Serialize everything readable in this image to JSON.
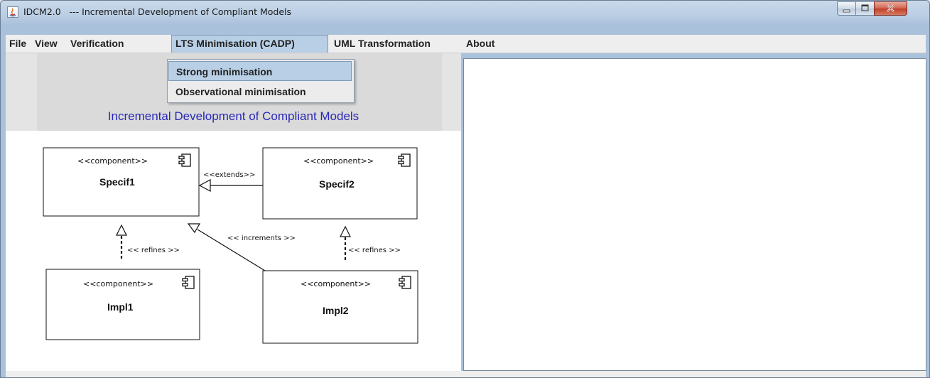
{
  "window": {
    "title": "IDCM2.0   --- Incremental Development of Compliant Models",
    "app_icon": "java-icon",
    "controls": [
      "minimize-icon",
      "maximize-icon",
      "close-icon"
    ]
  },
  "menubar": {
    "items": [
      "File",
      "View",
      "Verification",
      "LTS Minimisation (CADP)",
      "UML Transformation",
      "About"
    ],
    "active_item": "LTS Minimisation (CADP)"
  },
  "dropdown": {
    "items": [
      "Strong minimisation",
      "Observational minimisation"
    ],
    "highlighted": "Strong minimisation"
  },
  "banner": {
    "title": "Incremental Development of Compliant Models",
    "title_color": "#2a2ab8"
  },
  "diagram": {
    "components": [
      {
        "stereotype": "<<component>>",
        "name": "Specif1"
      },
      {
        "stereotype": "<<component>>",
        "name": "Specif2"
      },
      {
        "stereotype": "<<component>>",
        "name": "Impl1"
      },
      {
        "stereotype": "<<component>>",
        "name": "Impl2"
      }
    ],
    "relations": [
      {
        "label": "<<extends>>",
        "from": "Specif2",
        "to": "Specif1"
      },
      {
        "label": "<< refines >>",
        "from": "Impl1",
        "to": "Specif1"
      },
      {
        "label": "<< increments >>",
        "from": "Impl2",
        "to": "Specif1"
      },
      {
        "label": "<< refines >>",
        "from": "Impl2",
        "to": "Specif2"
      }
    ]
  },
  "colors": {
    "menu_highlight": "#b8cfe5",
    "close_button": "#c13d2a"
  }
}
